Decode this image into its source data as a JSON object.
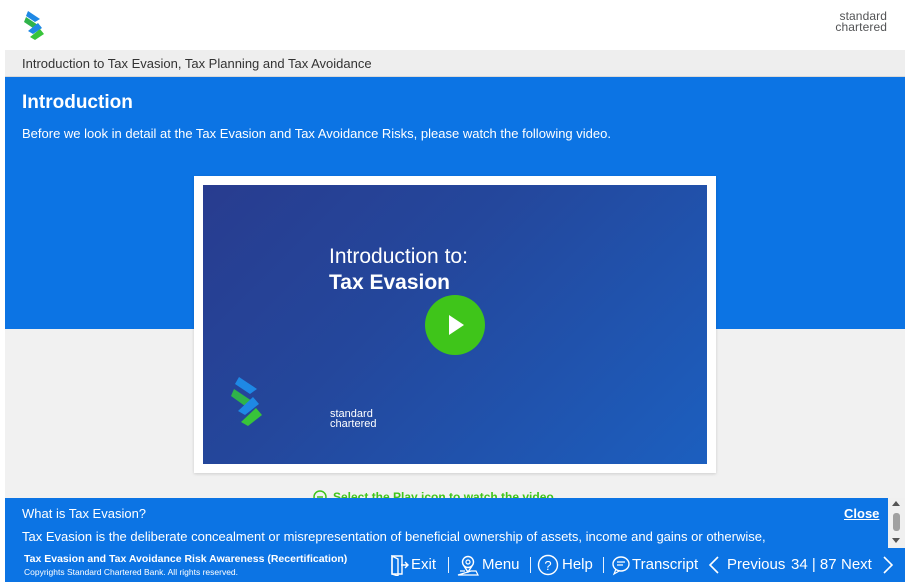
{
  "header": {
    "brand": [
      "standard",
      "chartered"
    ]
  },
  "breadcrumb": "Introduction to Tax Evasion, Tax Planning and Tax Avoidance",
  "content": {
    "title": "Introduction",
    "intro": "Before we look in detail at the Tax Evasion and Tax Avoidance Risks, please watch the following video.",
    "video": {
      "line1": "Introduction to:",
      "line2": "Tax Evasion",
      "brand": [
        "standard",
        "chartered"
      ],
      "play_icon": "play-icon"
    },
    "hint": "Select the Play icon to watch the video"
  },
  "panel": {
    "title": "What is Tax Evasion?",
    "close": "Close",
    "text": "Tax Evasion is the deliberate concealment or misrepresentation of beneficial ownership of assets, income and gains or otherwise,"
  },
  "footer": {
    "course_title": "Tax Evasion and Tax Avoidance Risk Awareness (Recertification)",
    "copyright": "Copyrights Standard Chartered Bank. All rights reserved.",
    "exit": "Exit",
    "menu": "Menu",
    "help": "Help",
    "transcript": "Transcript",
    "previous": "Previous",
    "page": "34 | 87",
    "next": "Next"
  },
  "colors": {
    "primary_blue": "#0c74e4",
    "green": "#3fc51a",
    "video_bg": "#283c8f"
  }
}
